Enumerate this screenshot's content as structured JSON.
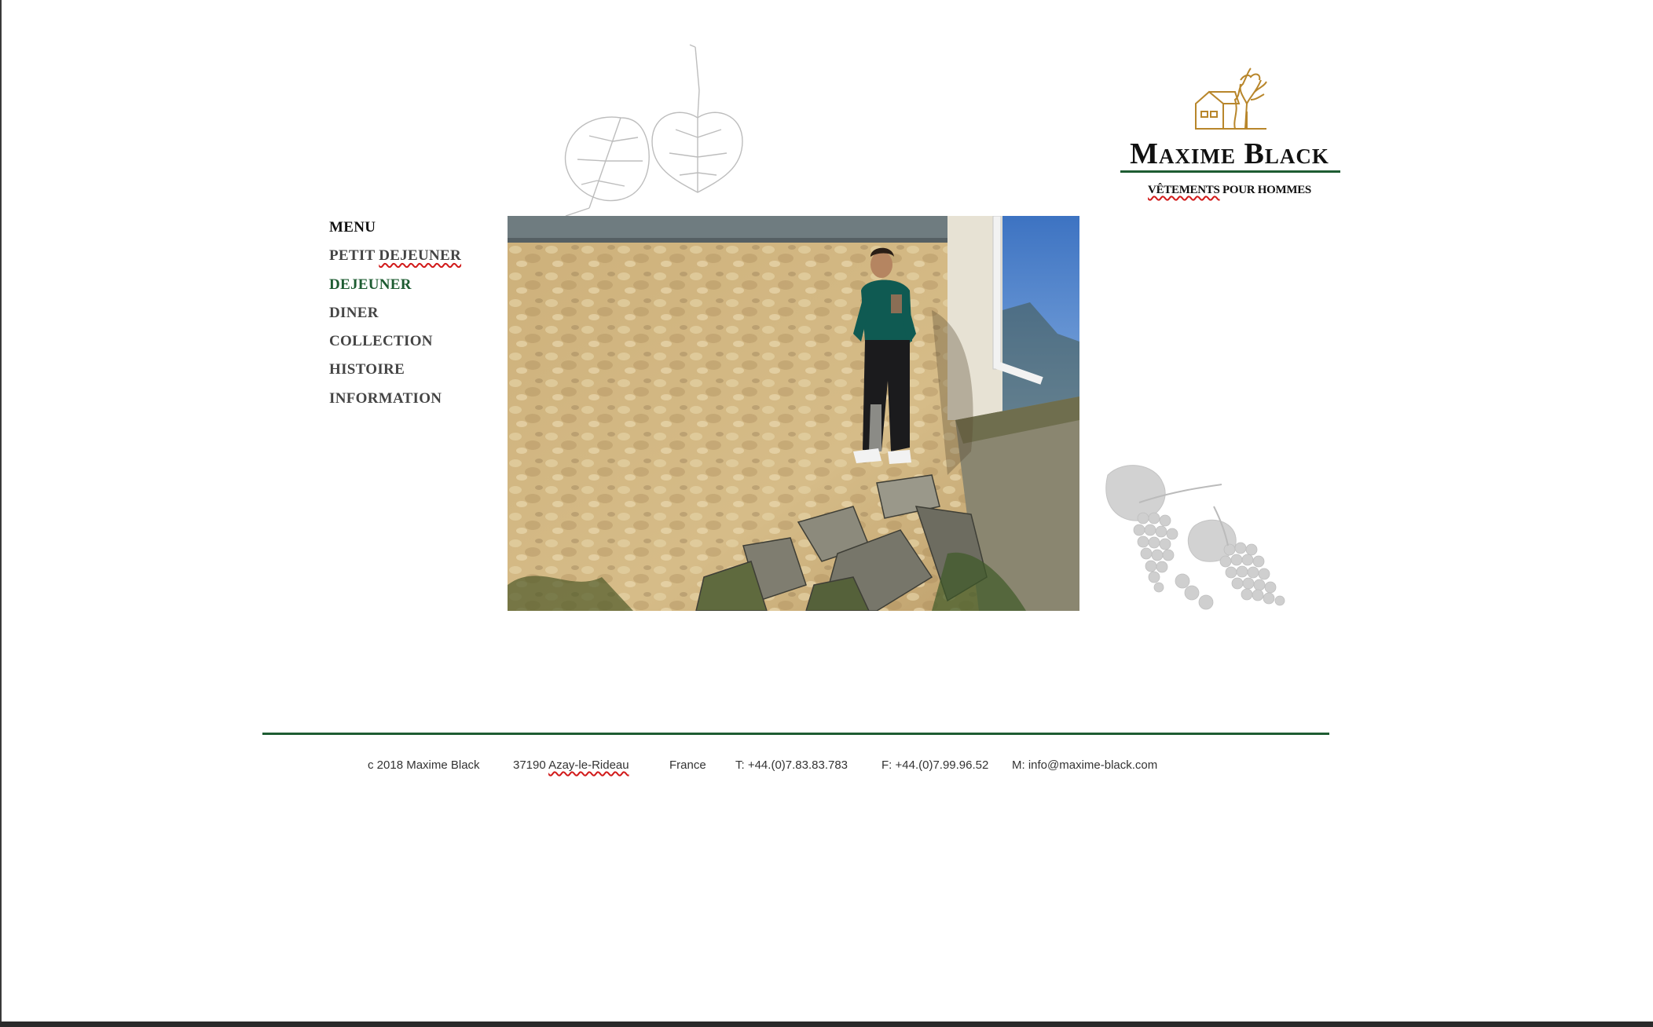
{
  "brand": {
    "name": "Maxime Black",
    "tagline_word1": "VÊTEMENTS",
    "tagline_rest": " POUR HOMMES",
    "accent_color": "#1e5c32",
    "logo_icon": "house-and-tree-icon"
  },
  "menu": {
    "heading": "MENU",
    "items": [
      {
        "label_a": "PETIT ",
        "label_b": "DEJEUNER",
        "active": false
      },
      {
        "label": "DEJEUNER",
        "active": true
      },
      {
        "label": "DINER",
        "active": false
      },
      {
        "label": "COLLECTION",
        "active": false
      },
      {
        "label": "HISTOIRE",
        "active": false
      },
      {
        "label": "INFORMATION",
        "active": false
      }
    ]
  },
  "decorations": {
    "top": "fig-leaves-icon",
    "bottom": "grapes-icon"
  },
  "hero": {
    "image": "man-standing-on-stone-blocks-photo"
  },
  "footer": {
    "copyright": "c 2018 Maxime Black",
    "postcode": "37190 ",
    "town": "Azay-le-Rideau",
    "country": "France",
    "phone": "T: +44.(0)7.83.83.783",
    "fax": "F: +44.(0)7.99.96.52",
    "email": "M: info@maxime-black.com"
  }
}
